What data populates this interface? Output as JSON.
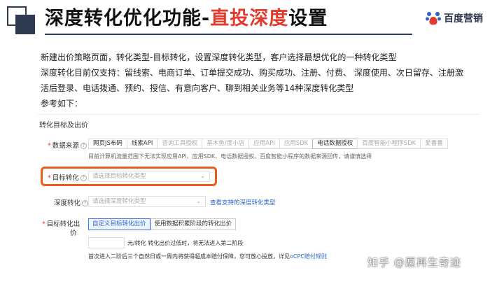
{
  "slide": {
    "title_prefix": "深度转化优化功能-",
    "title_highlight": "直投深度",
    "title_suffix": "设置",
    "brand_name": "百度营销",
    "intro_lines": [
      "新建出价策略页面，转化类型-目标转化，设置深度转化类型，客户选择最想优化的一种转化类型",
      "深度转化目前仅支持：留线索、电商订单、订单提交成功、购买成功、注册、付费、 深度使用、次日留存、注册激",
      "活后登录、电话拨通、预约、授信、有意向客户、聊到相关业务等14种深度转化类型",
      "参考如下："
    ]
  },
  "form": {
    "section_title": "转化目标及出价",
    "data_source": {
      "label": "数据来源",
      "help": "?",
      "tabs": [
        {
          "label": "网页JS布码",
          "state": "enabled"
        },
        {
          "label": "线索API",
          "state": "enabled"
        },
        {
          "label": "咨询工具授权",
          "state": "disabled"
        },
        {
          "label": "基木鱼/度小店",
          "state": "disabled"
        },
        {
          "label": "应用API",
          "state": "disabled"
        },
        {
          "label": "应用SDK",
          "state": "disabled"
        },
        {
          "label": "电话数据授权",
          "state": "active"
        },
        {
          "label": "百度智能小程序SDK",
          "state": "disabled"
        },
        {
          "label": "爱番番",
          "state": "disabled"
        }
      ],
      "hint": "目前计算机流量范围下无法实现应用API、应用SDK、电话数据授权、百度智能小程序的数据来源回传，请谨慎选择"
    },
    "target_conversion": {
      "label": "目标转化",
      "help": "?",
      "placeholder": "请选择目标转化类型",
      "chevron": "⌄"
    },
    "deep_conversion": {
      "label": "深度转化",
      "help": "?",
      "placeholder": "请选择深度转化类型",
      "chevron": "⌄",
      "link": "查看支持的深度转化类型"
    },
    "target_bid": {
      "label_line1": "目标转化出",
      "label_line2": "价",
      "buttons": [
        {
          "label": "自定义目标转化出价",
          "active": true
        },
        {
          "label": "使用数据积累阶段的转化出价",
          "active": false
        }
      ],
      "unit_hint": "元/转化  转化出价过低时，将无法进入第二阶段",
      "note": "首次进入二阶后三个自然日或一周内将获得超成本赔付保障，您可放心投放，详见",
      "note_link": "oCPC赔付规则"
    }
  },
  "watermark": "知乎 @愿再生奇迹",
  "colors": {
    "accent_red": "#e23a2e",
    "highlight_orange": "#ef5a1e",
    "link_blue": "#2a63c9",
    "header_navy": "#2d3a4f"
  }
}
